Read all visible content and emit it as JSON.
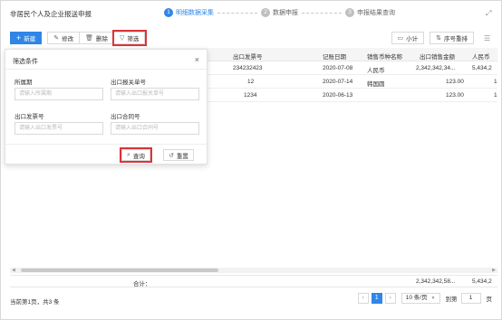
{
  "header": {
    "title": "非居民个人及企业报送申报",
    "steps": [
      {
        "num": "1",
        "label": "明细数据采集"
      },
      {
        "num": "2",
        "label": "数据申报"
      },
      {
        "num": "3",
        "label": "申报结果查询"
      }
    ]
  },
  "toolbar": {
    "new_label": "新建",
    "edit_label": "修改",
    "delete_label": "删除",
    "filter_label": "筛选",
    "subtotal_label": "小计",
    "reorder_label": "序号重排"
  },
  "table": {
    "columns": [
      "出口发票号",
      "记账日期",
      "销售币种名称",
      "出口销售金额",
      "人民币"
    ],
    "rows": [
      {
        "invoice": "234232423",
        "date": "2020-07-08",
        "currency": "人民币",
        "amount": "2,342,342,34...",
        "rmb": "5,434,2"
      },
      {
        "invoice": "12",
        "date": "2020-07-14",
        "currency": "韩国圆",
        "amount": "123.00",
        "rmb": "1"
      },
      {
        "invoice": "1234",
        "date": "2020-06-13",
        "currency": "",
        "amount": "123.00",
        "rmb": "1"
      }
    ],
    "total_label": "合计：",
    "total_amount": "2,342,342,58...",
    "total_rmb": "5,434,2"
  },
  "pagination": {
    "info": "当前第1页，共3 条",
    "current_page": "1",
    "page_size": "10 条/页",
    "goto_label": "到第",
    "goto_value": "1",
    "page_unit": "页"
  },
  "filter": {
    "title": "筛选条件",
    "fields": [
      {
        "label": "所属期",
        "placeholder": "请输入所属期"
      },
      {
        "label": "出口报关单号",
        "placeholder": "请输入出口报关单号"
      },
      {
        "label": "出口发票号",
        "placeholder": "请输入出口发票号"
      },
      {
        "label": "出口合同号",
        "placeholder": "请输入出口合同号"
      }
    ],
    "query_label": "查询",
    "reset_label": "重置"
  },
  "colors": {
    "accent": "#2f86e6",
    "highlight": "#d9343a"
  }
}
